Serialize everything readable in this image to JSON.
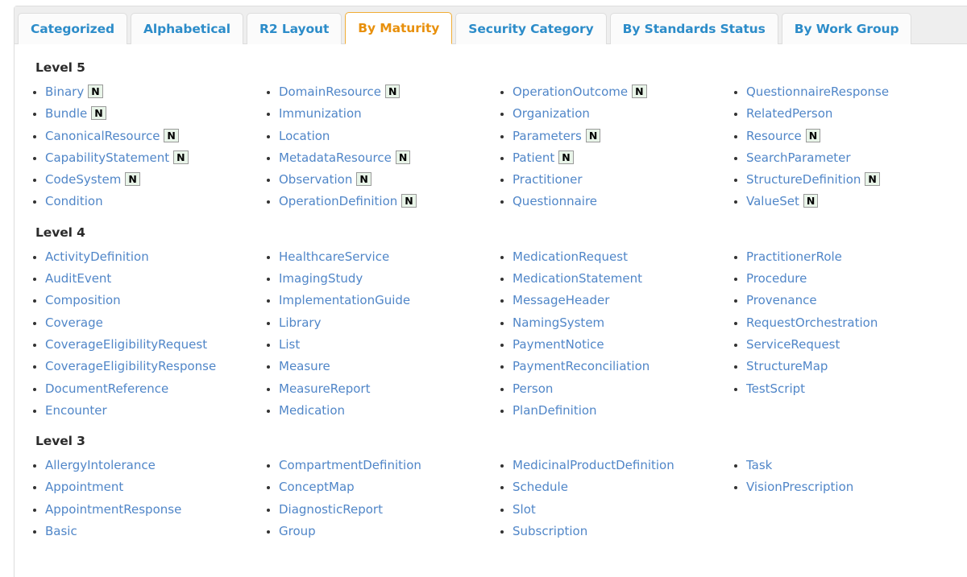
{
  "tabs": [
    {
      "label": "Categorized",
      "active": false
    },
    {
      "label": "Alphabetical",
      "active": false
    },
    {
      "label": "R2 Layout",
      "active": false
    },
    {
      "label": "By Maturity",
      "active": true
    },
    {
      "label": "Security Category",
      "active": false
    },
    {
      "label": "By Standards Status",
      "active": false
    },
    {
      "label": "By Work Group",
      "active": false
    }
  ],
  "colors": {
    "tab_link": "#2c8cc9",
    "tab_active_text": "#e8900c",
    "tab_active_border": "#f0ad35",
    "resource_link": "#5086c8",
    "badge_background": "#e9f5e9",
    "badge_border": "#9a9a9a",
    "strip_background": "#eeeeee",
    "panel_border": "#dddddd"
  },
  "badge": {
    "normative_label": "N"
  },
  "levels": [
    {
      "heading": "Level 5",
      "columns": [
        [
          {
            "name": "Binary",
            "badge": "N"
          },
          {
            "name": "Bundle",
            "badge": "N"
          },
          {
            "name": "CanonicalResource",
            "badge": "N"
          },
          {
            "name": "CapabilityStatement",
            "badge": "N"
          },
          {
            "name": "CodeSystem",
            "badge": "N"
          },
          {
            "name": "Condition",
            "badge": null
          }
        ],
        [
          {
            "name": "DomainResource",
            "badge": "N"
          },
          {
            "name": "Immunization",
            "badge": null
          },
          {
            "name": "Location",
            "badge": null
          },
          {
            "name": "MetadataResource",
            "badge": "N"
          },
          {
            "name": "Observation",
            "badge": "N"
          },
          {
            "name": "OperationDefinition",
            "badge": "N"
          }
        ],
        [
          {
            "name": "OperationOutcome",
            "badge": "N"
          },
          {
            "name": "Organization",
            "badge": null
          },
          {
            "name": "Parameters",
            "badge": "N"
          },
          {
            "name": "Patient",
            "badge": "N"
          },
          {
            "name": "Practitioner",
            "badge": null
          },
          {
            "name": "Questionnaire",
            "badge": null
          }
        ],
        [
          {
            "name": "QuestionnaireResponse",
            "badge": null
          },
          {
            "name": "RelatedPerson",
            "badge": null
          },
          {
            "name": "Resource",
            "badge": "N"
          },
          {
            "name": "SearchParameter",
            "badge": null
          },
          {
            "name": "StructureDefinition",
            "badge": "N"
          },
          {
            "name": "ValueSet",
            "badge": "N"
          }
        ]
      ]
    },
    {
      "heading": "Level 4",
      "columns": [
        [
          {
            "name": "ActivityDefinition",
            "badge": null
          },
          {
            "name": "AuditEvent",
            "badge": null
          },
          {
            "name": "Composition",
            "badge": null
          },
          {
            "name": "Coverage",
            "badge": null
          },
          {
            "name": "CoverageEligibilityRequest",
            "badge": null
          },
          {
            "name": "CoverageEligibilityResponse",
            "badge": null
          },
          {
            "name": "DocumentReference",
            "badge": null
          },
          {
            "name": "Encounter",
            "badge": null
          }
        ],
        [
          {
            "name": "HealthcareService",
            "badge": null
          },
          {
            "name": "ImagingStudy",
            "badge": null
          },
          {
            "name": "ImplementationGuide",
            "badge": null
          },
          {
            "name": "Library",
            "badge": null
          },
          {
            "name": "List",
            "badge": null
          },
          {
            "name": "Measure",
            "badge": null
          },
          {
            "name": "MeasureReport",
            "badge": null
          },
          {
            "name": "Medication",
            "badge": null
          }
        ],
        [
          {
            "name": "MedicationRequest",
            "badge": null
          },
          {
            "name": "MedicationStatement",
            "badge": null
          },
          {
            "name": "MessageHeader",
            "badge": null
          },
          {
            "name": "NamingSystem",
            "badge": null
          },
          {
            "name": "PaymentNotice",
            "badge": null
          },
          {
            "name": "PaymentReconciliation",
            "badge": null
          },
          {
            "name": "Person",
            "badge": null
          },
          {
            "name": "PlanDefinition",
            "badge": null
          }
        ],
        [
          {
            "name": "PractitionerRole",
            "badge": null
          },
          {
            "name": "Procedure",
            "badge": null
          },
          {
            "name": "Provenance",
            "badge": null
          },
          {
            "name": "RequestOrchestration",
            "badge": null
          },
          {
            "name": "ServiceRequest",
            "badge": null
          },
          {
            "name": "StructureMap",
            "badge": null
          },
          {
            "name": "TestScript",
            "badge": null
          }
        ]
      ]
    },
    {
      "heading": "Level 3",
      "columns": [
        [
          {
            "name": "AllergyIntolerance",
            "badge": null
          },
          {
            "name": "Appointment",
            "badge": null
          },
          {
            "name": "AppointmentResponse",
            "badge": null
          },
          {
            "name": "Basic",
            "badge": null
          }
        ],
        [
          {
            "name": "CompartmentDefinition",
            "badge": null
          },
          {
            "name": "ConceptMap",
            "badge": null
          },
          {
            "name": "DiagnosticReport",
            "badge": null
          },
          {
            "name": "Group",
            "badge": null
          }
        ],
        [
          {
            "name": "MedicinalProductDefinition",
            "badge": null
          },
          {
            "name": "Schedule",
            "badge": null
          },
          {
            "name": "Slot",
            "badge": null
          },
          {
            "name": "Subscription",
            "badge": null
          }
        ],
        [
          {
            "name": "Task",
            "badge": null
          },
          {
            "name": "VisionPrescription",
            "badge": null
          }
        ]
      ]
    }
  ]
}
